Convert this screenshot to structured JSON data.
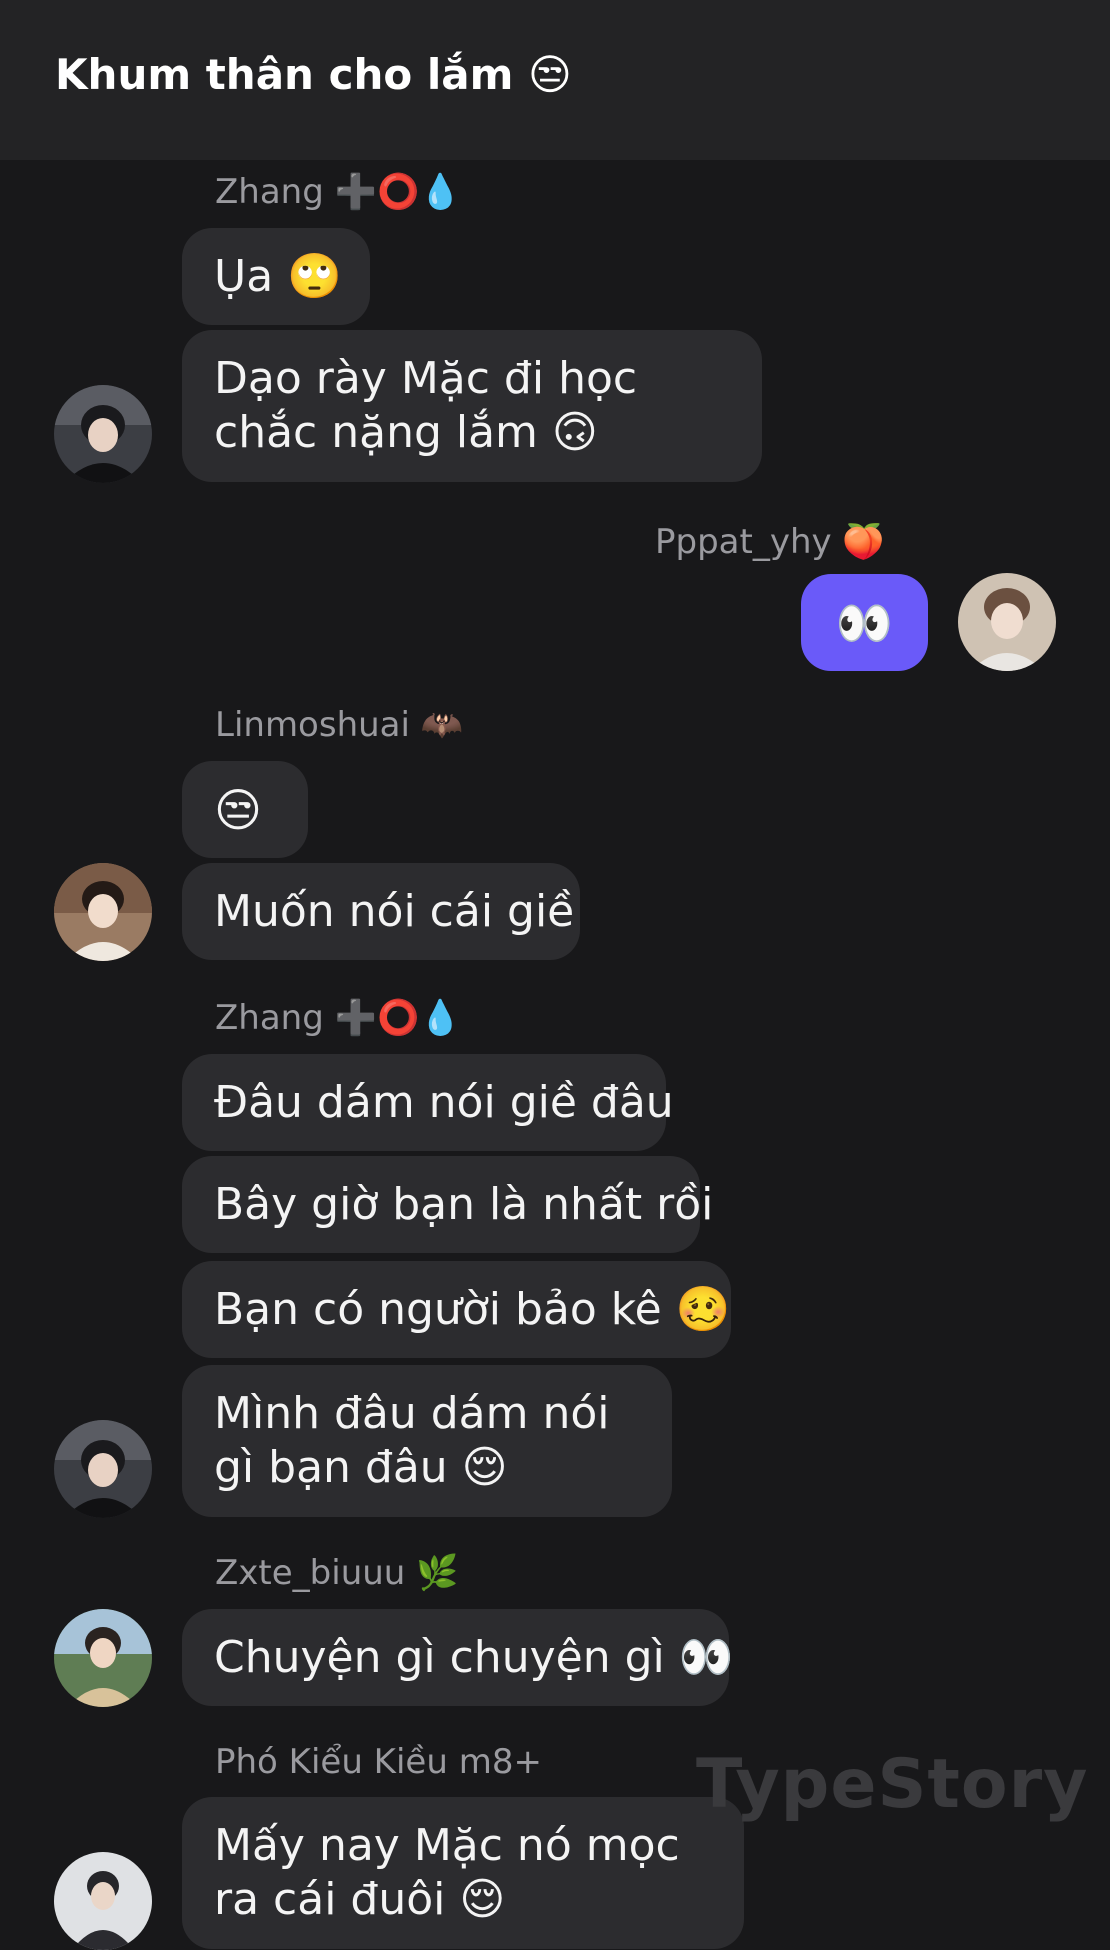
{
  "header": {
    "title": "Khum thân cho lắm 😒"
  },
  "groups": [
    {
      "sender": "Zhang ➕⭕💧",
      "avatar": "avatar-zhang",
      "messages": [
        "Ụa 🙄",
        "Dạo rày Mặc đi học chắc nặng lắm 🙃"
      ]
    },
    {
      "sender": "Pppat_yhy 🍑",
      "avatar": "avatar-pppat",
      "messages": [
        "👀"
      ]
    },
    {
      "sender": "Linmoshuai 🦇",
      "avatar": "avatar-linmoshuai",
      "messages": [
        "😒",
        "Muốn nói cái giề"
      ]
    },
    {
      "sender": "Zhang ➕⭕💧",
      "avatar": "avatar-zhang",
      "messages": [
        "Đâu dám nói giề đâu",
        "Bây giờ bạn là nhất rồi",
        "Bạn có người bảo kê 🥴",
        "Mình đâu dám nói gì bạn đâu 😌"
      ]
    },
    {
      "sender": "Zxte_biuuu 🌿",
      "avatar": "avatar-zxte",
      "messages": [
        "Chuyện gì chuyện gì 👀"
      ]
    },
    {
      "sender": "Phó Kiểu Kiều m8+",
      "avatar": "avatar-pho",
      "messages": [
        "Mấy nay Mặc nó mọc ra cái đuôi 😌"
      ]
    }
  ],
  "watermark": "TypeStory",
  "colors": {
    "background": "#18181a",
    "header": "#232325",
    "bubble_other": "#2c2c2f",
    "bubble_mine": "#6a5af9",
    "sender_text": "#9a9a9f"
  }
}
